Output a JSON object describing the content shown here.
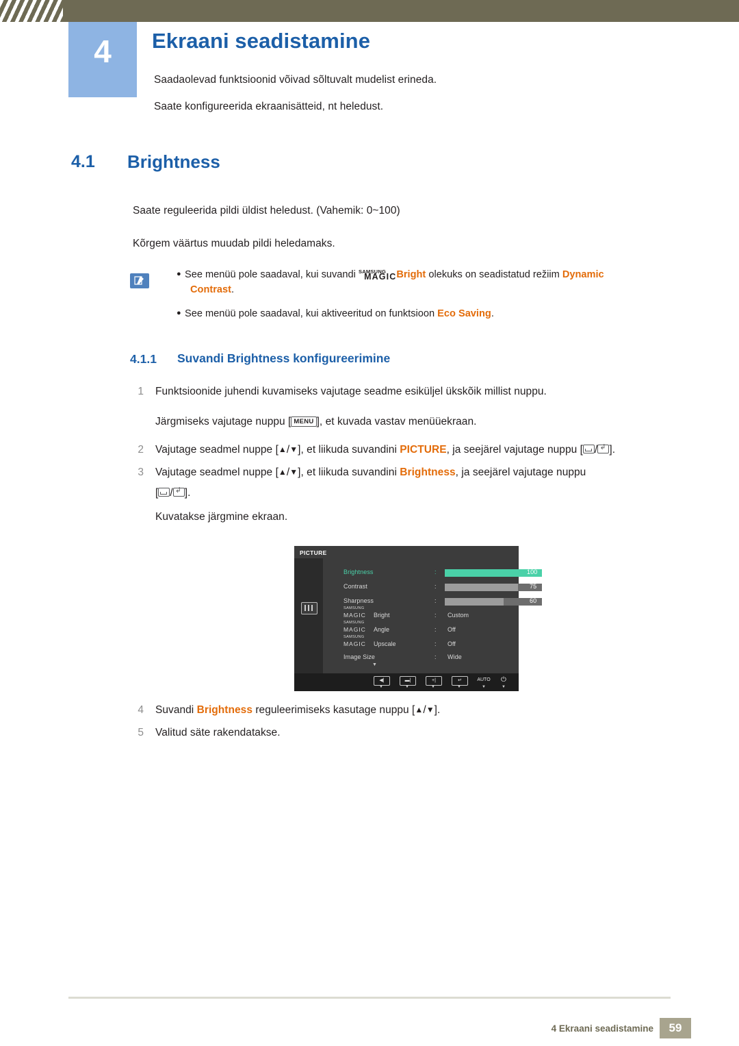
{
  "header": {
    "chapter_number": "4",
    "chapter_title": "Ekraani seadistamine",
    "intro_line_1": "Saadaolevad funktsioonid võivad sõltuvalt mudelist erineda.",
    "intro_line_2": "Saate konfigureerida ekraanisätteid, nt heledust."
  },
  "section": {
    "number": "4.1",
    "title": "Brightness",
    "paragraph_1": "Saate reguleerida pildi üldist heledust. (Vahemik: 0~100)",
    "paragraph_2": "Kõrgem väärtus muudab pildi heledamaks."
  },
  "note": {
    "bullet_1_pre": "See menüü pole saadaval, kui suvandi ",
    "bullet_1_samsung": "SAMSUNG",
    "bullet_1_magic": "MAGIC",
    "bullet_1_bright": "Bright",
    "bullet_1_mid": " olekuks on seadistatud režiim ",
    "bullet_1_highlight": "Dynamic",
    "bullet_1_line2_highlight": "Contrast",
    "bullet_1_line2_tail": ".",
    "bullet_2_pre": "See menüü pole saadaval, kui aktiveeritud on funktsioon ",
    "bullet_2_highlight": "Eco Saving",
    "bullet_2_tail": "."
  },
  "subsection": {
    "number": "4.1.1",
    "title": "Suvandi Brightness konfigureerimine"
  },
  "steps": {
    "n1": "1",
    "t1": "Funktsioonide juhendi kuvamiseks vajutage seadme esiküljel ükskõik millist nuppu.",
    "t1b_pre": "Järgmiseks vajutage nuppu [",
    "t1b_key": "MENU",
    "t1b_post": "], et kuvada vastav menüüekraan.",
    "n2": "2",
    "t2_pre": "Vajutage seadmel nuppe [",
    "t2_mid": "], et liikuda suvandini ",
    "t2_highlight": "PICTURE",
    "t2_post": ", ja seejärel vajutage nuppu [",
    "t2_end": "].",
    "n3": "3",
    "t3_pre": "Vajutage seadmel nuppe [",
    "t3_mid": "], et liikuda suvandini ",
    "t3_highlight": "Brightness",
    "t3_post": ", ja seejärel vajutage nuppu",
    "t3_line2_end": "].",
    "t3_line3": "Kuvatakse järgmine ekraan.",
    "n4": "4",
    "t4_pre": "Suvandi ",
    "t4_highlight": "Brightness",
    "t4_mid": " reguleerimiseks kasutage nuppu [",
    "t4_end": "].",
    "n5": "5",
    "t5": "Valitud säte rakendatakse."
  },
  "osd": {
    "title": "PICTURE",
    "rows": [
      {
        "label": "Brightness",
        "value": "100",
        "type": "bar",
        "fill": 100,
        "selected": true
      },
      {
        "label": "Contrast",
        "value": "75",
        "type": "bar",
        "fill": 75,
        "selected": false
      },
      {
        "label": "Sharpness",
        "value": "60",
        "type": "bar",
        "fill": 60,
        "selected": false
      }
    ],
    "magic_rows": [
      {
        "samsung": "SAMSUNG",
        "magic": "MAGIC",
        "name": "Bright",
        "value": "Custom"
      },
      {
        "samsung": "SAMSUNG",
        "magic": "MAGIC",
        "name": "Angle",
        "value": "Off"
      },
      {
        "samsung": "SAMSUNG",
        "magic": "MAGIC",
        "name": "Upscale",
        "value": "Off"
      }
    ],
    "plain_rows": [
      {
        "label": "Image Size",
        "value": "Wide"
      }
    ],
    "buttons": [
      "◀|",
      "—|",
      "+|",
      "↵",
      "AUTO",
      "⏻"
    ],
    "auto_label": "AUTO",
    "accent_color": "#4ad1a8"
  },
  "footer": {
    "text": "4 Ekraani seadistamine",
    "page": "59"
  }
}
